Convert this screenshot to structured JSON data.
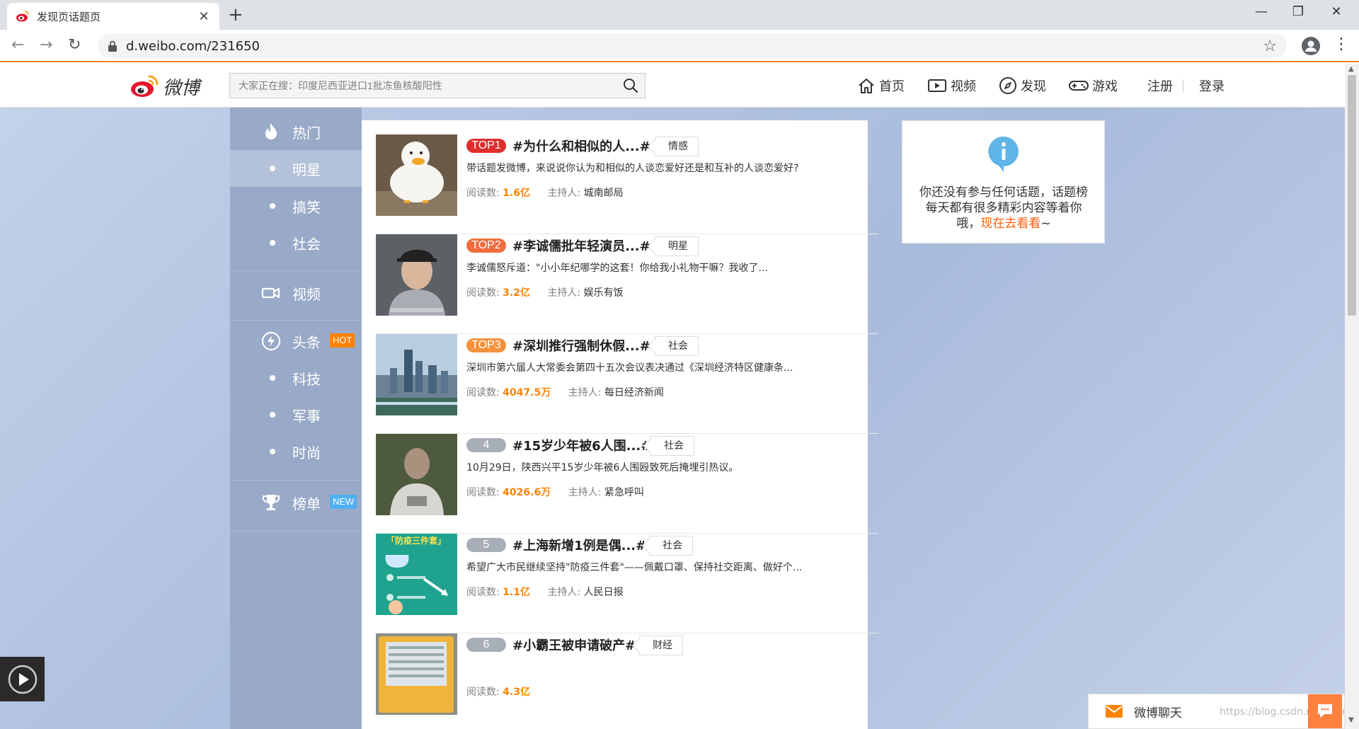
{
  "browser": {
    "tab_title": "发现页话题页",
    "new_tab": "+",
    "tab_close": "✕",
    "url": "d.weibo.com/231650",
    "window_controls": {
      "minimize": "—",
      "maximize": "❐",
      "close": "✕"
    }
  },
  "header": {
    "logo_text": "微博",
    "search_placeholder": "大家正在搜：印度尼西亚进口1批冻鱼核酸阳性",
    "nav": {
      "home": "首页",
      "video": "视频",
      "discover": "发现",
      "game": "游戏",
      "register": "注册",
      "login": "登录"
    }
  },
  "sidebar": {
    "hot": "热门",
    "star": "明星",
    "funny": "搞笑",
    "society": "社会",
    "video": "视频",
    "headline": "头条",
    "headline_badge": "HOT",
    "tech": "科技",
    "military": "军事",
    "fashion": "时尚",
    "ranking": "榜单",
    "ranking_badge": "NEW"
  },
  "topics": [
    {
      "rank": "TOP1",
      "title": "#为什么和相似的人...#",
      "tag": "情感",
      "desc": "带话题发微博，来说说你认为和相似的人谈恋爱好还是和互补的人谈恋爱好?",
      "reads_label": "阅读数:",
      "reads": "1.6亿",
      "host_label": "主持人:",
      "host": "城南邮局"
    },
    {
      "rank": "TOP2",
      "title": "#李诚儒批年轻演员...#",
      "tag": "明星",
      "desc": "李诚儒怒斥道：\"小小年纪哪学的这套！你给我小礼物干嘛？我收了...",
      "reads_label": "阅读数:",
      "reads": "3.2亿",
      "host_label": "主持人:",
      "host": "娱乐有饭"
    },
    {
      "rank": "TOP3",
      "title": "#深圳推行强制休假...#",
      "tag": "社会",
      "desc": "深圳市第六届人大常委会第四十五次会议表决通过《深圳经济特区健康条...",
      "reads_label": "阅读数:",
      "reads": "4047.5万",
      "host_label": "主持人:",
      "host": "每日经济新闻"
    },
    {
      "rank": "4",
      "title": "#15岁少年被6人围...#",
      "tag": "社会",
      "desc": "10月29日，陕西兴平15岁少年被6人围殴致死后掩埋引热议。",
      "reads_label": "阅读数:",
      "reads": "4026.6万",
      "host_label": "主持人:",
      "host": "紧急呼叫"
    },
    {
      "rank": "5",
      "title": "#上海新增1例是偶...#",
      "tag": "社会",
      "desc": "希望广大市民继续坚持\"防疫三件套\"——佩戴口罩、保持社交距离、做好个...",
      "reads_label": "阅读数:",
      "reads": "1.1亿",
      "host_label": "主持人:",
      "host": "人民日报",
      "thumb_text": "「防疫三件套」"
    },
    {
      "rank": "6",
      "title": "#小霸王被申请破产#",
      "tag": "财经",
      "desc": "",
      "reads_label": "阅读数:",
      "reads": "4.3亿"
    }
  ],
  "right_panel": {
    "text": "你还没有参与任何话题，话题榜每天都有很多精彩内容等着你哦，",
    "link": "现在去看看",
    "tail": "~"
  },
  "chat": {
    "label": "微博聊天",
    "watermark": "https://blog.csdn.net/Fesrp"
  },
  "colors": {
    "brand_orange": "#ff8200",
    "top1": "#e02d2d",
    "top2": "#f26d3d",
    "top3": "#f5923c",
    "rank_gray": "#a8aeb8",
    "sidebar": "#99aac8"
  }
}
